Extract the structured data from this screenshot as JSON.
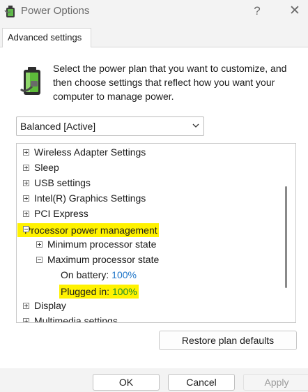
{
  "window": {
    "title": "Power Options",
    "help_label": "?",
    "close_label": "✕"
  },
  "tab": {
    "label": "Advanced settings"
  },
  "description": "Select the power plan that you want to customize, and then choose settings that reflect how you want your computer to manage power.",
  "plan_select": {
    "value": "Balanced [Active]"
  },
  "tree": {
    "wireless": "Wireless Adapter Settings",
    "sleep": "Sleep",
    "usb": "USB settings",
    "intel": "Intel(R) Graphics Settings",
    "pci": "PCI Express",
    "ppm": "Processor power management",
    "min_state": "Minimum processor state",
    "max_state": "Maximum processor state",
    "on_battery_label": "On battery:",
    "on_battery_value": "100%",
    "plugged_in_label": "Plugged in:",
    "plugged_in_value": "100%",
    "display": "Display",
    "multimedia": "Multimedia settings"
  },
  "buttons": {
    "restore": "Restore plan defaults",
    "ok": "OK",
    "cancel": "Cancel",
    "apply": "Apply"
  },
  "colors": {
    "highlight": "#fff200",
    "value_blue": "#1a73c8"
  }
}
